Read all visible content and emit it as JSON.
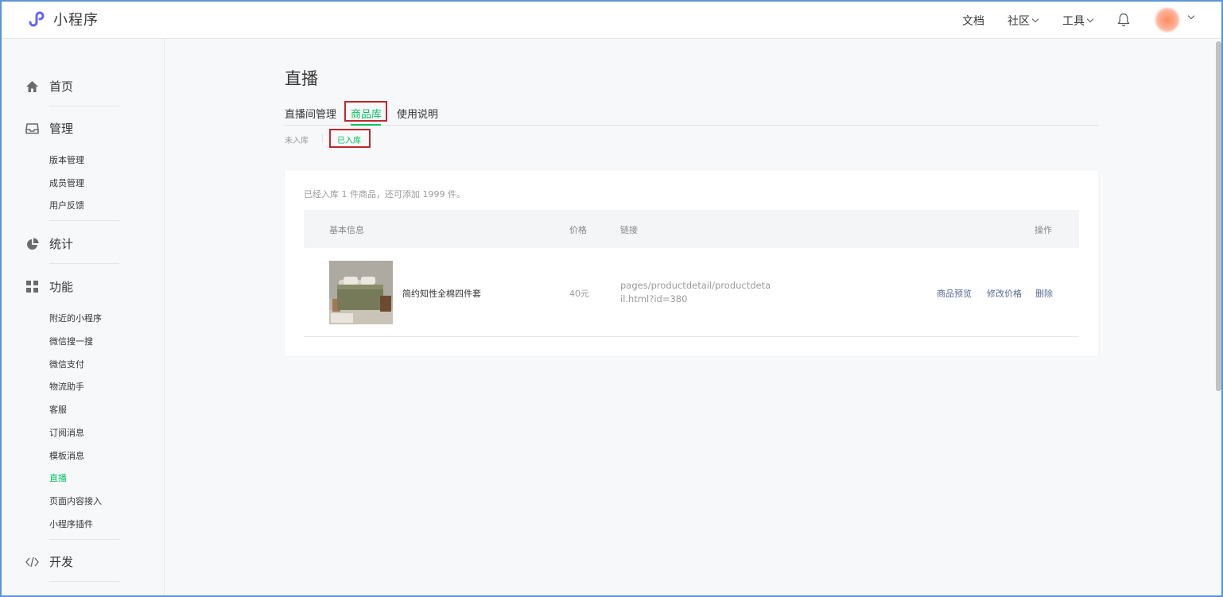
{
  "app": {
    "title": "小程序"
  },
  "topnav": {
    "docs": "文档",
    "community": "社区",
    "tools": "工具"
  },
  "sidebar": {
    "home": "首页",
    "manage": "管理",
    "manage_items": [
      "版本管理",
      "成员管理",
      "用户反馈"
    ],
    "stats": "统计",
    "features": "功能",
    "feature_items": [
      "附近的小程序",
      "微信搜一搜",
      "微信支付",
      "物流助手",
      "客服",
      "订阅消息",
      "模板消息",
      "直播",
      "页面内容接入",
      "小程序插件"
    ],
    "active_item": "直播",
    "develop": "开发"
  },
  "main": {
    "title": "直播",
    "tabs": [
      "直播间管理",
      "商品库",
      "使用说明"
    ],
    "active_tab": "商品库",
    "subtabs": [
      "未入库",
      "已入库"
    ],
    "active_subtab": "已入库",
    "summary": "已经入库 1 件商品，还可添加 1999 件。",
    "table": {
      "headers": {
        "info": "基本信息",
        "price": "价格",
        "link": "链接",
        "ops": "操作"
      },
      "rows": [
        {
          "name": "简约知性全棉四件套",
          "price": "40元",
          "link": "pages/productdetail/productdetail.html?id=380",
          "ops": [
            "商品预览",
            "修改价格",
            "删除"
          ]
        }
      ]
    }
  },
  "colors": {
    "accent": "#07c160",
    "link": "#576b95",
    "highlight": "#c1272d"
  }
}
